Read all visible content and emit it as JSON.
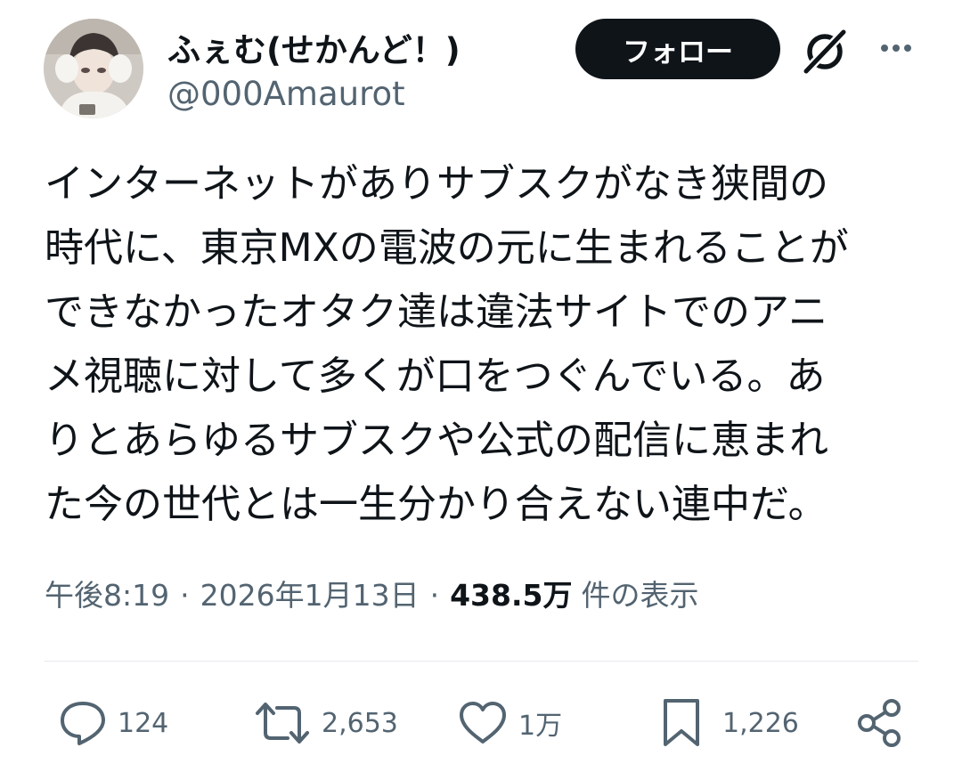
{
  "author": {
    "display_name": "ふぇむ(せかんど！)",
    "handle": "@000Amaurot"
  },
  "header": {
    "follow_label": "フォロー",
    "icons": [
      "grok-icon",
      "more-icon"
    ]
  },
  "tweet": {
    "lines": [
      "インターネットがありサブスクがなき狭間の",
      "時代に、東京MXの電波の元に生まれることが",
      "できなかったオタク達は違法サイトでのアニ",
      "メ視聴に対して多くが口をつぐんでいる。あ",
      "りとあらゆるサブスクや公式の配信に恵まれ",
      "た今の世代とは一生分かり合えない連中だ。"
    ]
  },
  "meta": {
    "time": "午後8:19",
    "separator": "·",
    "date": "2026年1月13日",
    "views_count": "438.5万",
    "views_label": "件の表示"
  },
  "actions": {
    "reply": {
      "icon": "reply-icon",
      "count": "124"
    },
    "retweet": {
      "icon": "retweet-icon",
      "count": "2,653"
    },
    "like": {
      "icon": "heart-icon",
      "count": "1万"
    },
    "bookmark": {
      "icon": "bookmark-icon",
      "count": "1,226"
    },
    "share": {
      "icon": "share-icon"
    }
  },
  "colors": {
    "text": "#0f1419",
    "secondary": "#536471",
    "follow_bg": "#0f1419",
    "follow_text": "#ffffff",
    "divider": "#e6e9ec"
  }
}
